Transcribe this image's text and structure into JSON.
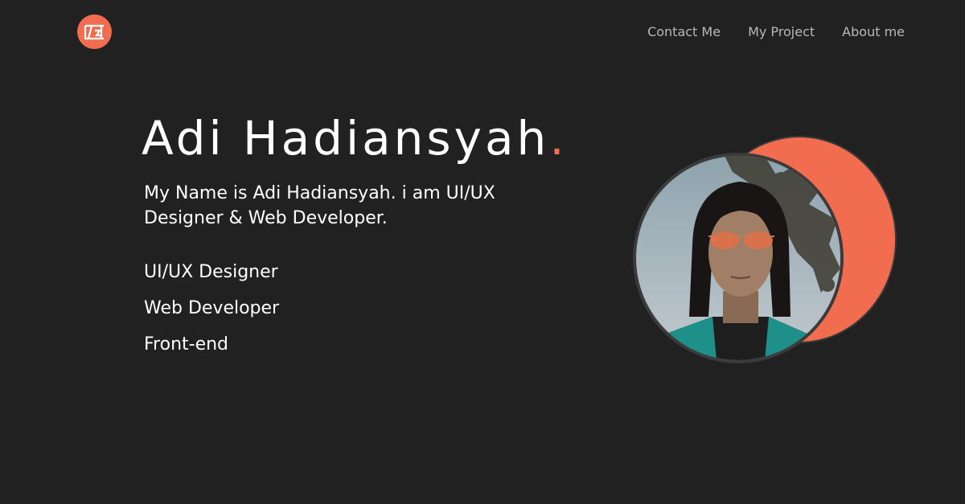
{
  "header": {
    "logo_text": "ZST",
    "nav": [
      {
        "label": "Contact Me"
      },
      {
        "label": "My Project"
      },
      {
        "label": "About me"
      }
    ]
  },
  "hero": {
    "name": "Adi Hadiansyah",
    "name_dot": ".",
    "intro": "My Name is Adi Hadiansyah. i am UI/UX Designer & Web Developer.",
    "roles": [
      {
        "label": "UI/UX Designer"
      },
      {
        "label": "Web Developer"
      },
      {
        "label": "Front-end"
      }
    ]
  },
  "colors": {
    "background": "#212121",
    "accent": "#f26d4f",
    "text": "#ffffff",
    "nav_text": "#b8b8b8"
  }
}
